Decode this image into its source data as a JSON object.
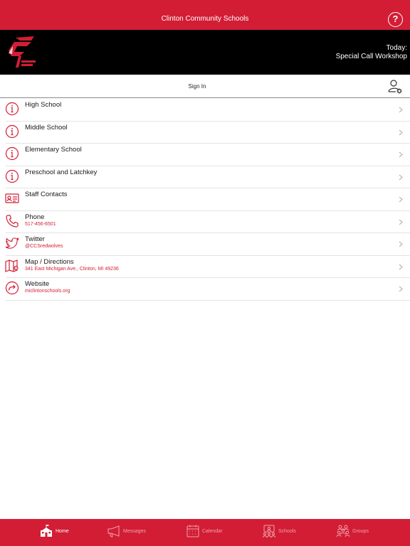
{
  "header": {
    "title": "Clinton Community Schools",
    "help_icon": "question-circle-icon"
  },
  "banner": {
    "today_label": "Today:",
    "today_event": "Special Call Workshop"
  },
  "signin": {
    "label": "Sign In",
    "icon": "user-gear-icon"
  },
  "colors": {
    "brand": "#d21d35",
    "banner_bg": "#000000",
    "link": "#d21d35"
  },
  "items": [
    {
      "title": "High School",
      "subtitle": "",
      "icon": "info-circle-icon"
    },
    {
      "title": "Middle School",
      "subtitle": "",
      "icon": "info-circle-icon"
    },
    {
      "title": "Elementary School",
      "subtitle": "",
      "icon": "info-circle-icon"
    },
    {
      "title": "Preschool and Latchkey",
      "subtitle": "",
      "icon": "info-circle-icon"
    },
    {
      "title": "Staff Contacts",
      "subtitle": "",
      "icon": "contact-card-icon"
    },
    {
      "title": "Phone",
      "subtitle": "517-456-6501",
      "icon": "phone-icon"
    },
    {
      "title": "Twitter",
      "subtitle": "@CCSredwolves",
      "icon": "twitter-icon"
    },
    {
      "title": "Map / Directions",
      "subtitle": "341 East Michigan Ave., Clinton, MI 49236",
      "icon": "map-icon"
    },
    {
      "title": "Website",
      "subtitle": "miclintonschools.org",
      "icon": "share-arrow-icon"
    }
  ],
  "tabs": [
    {
      "label": "Home",
      "icon": "schoolhouse-icon",
      "active": true
    },
    {
      "label": "Messages",
      "icon": "megaphone-icon",
      "active": false
    },
    {
      "label": "Calendar",
      "icon": "calendar-icon",
      "active": false
    },
    {
      "label": "Schools",
      "icon": "school-group-icon",
      "active": false
    },
    {
      "label": "Groups",
      "icon": "people-group-icon",
      "active": false
    }
  ]
}
